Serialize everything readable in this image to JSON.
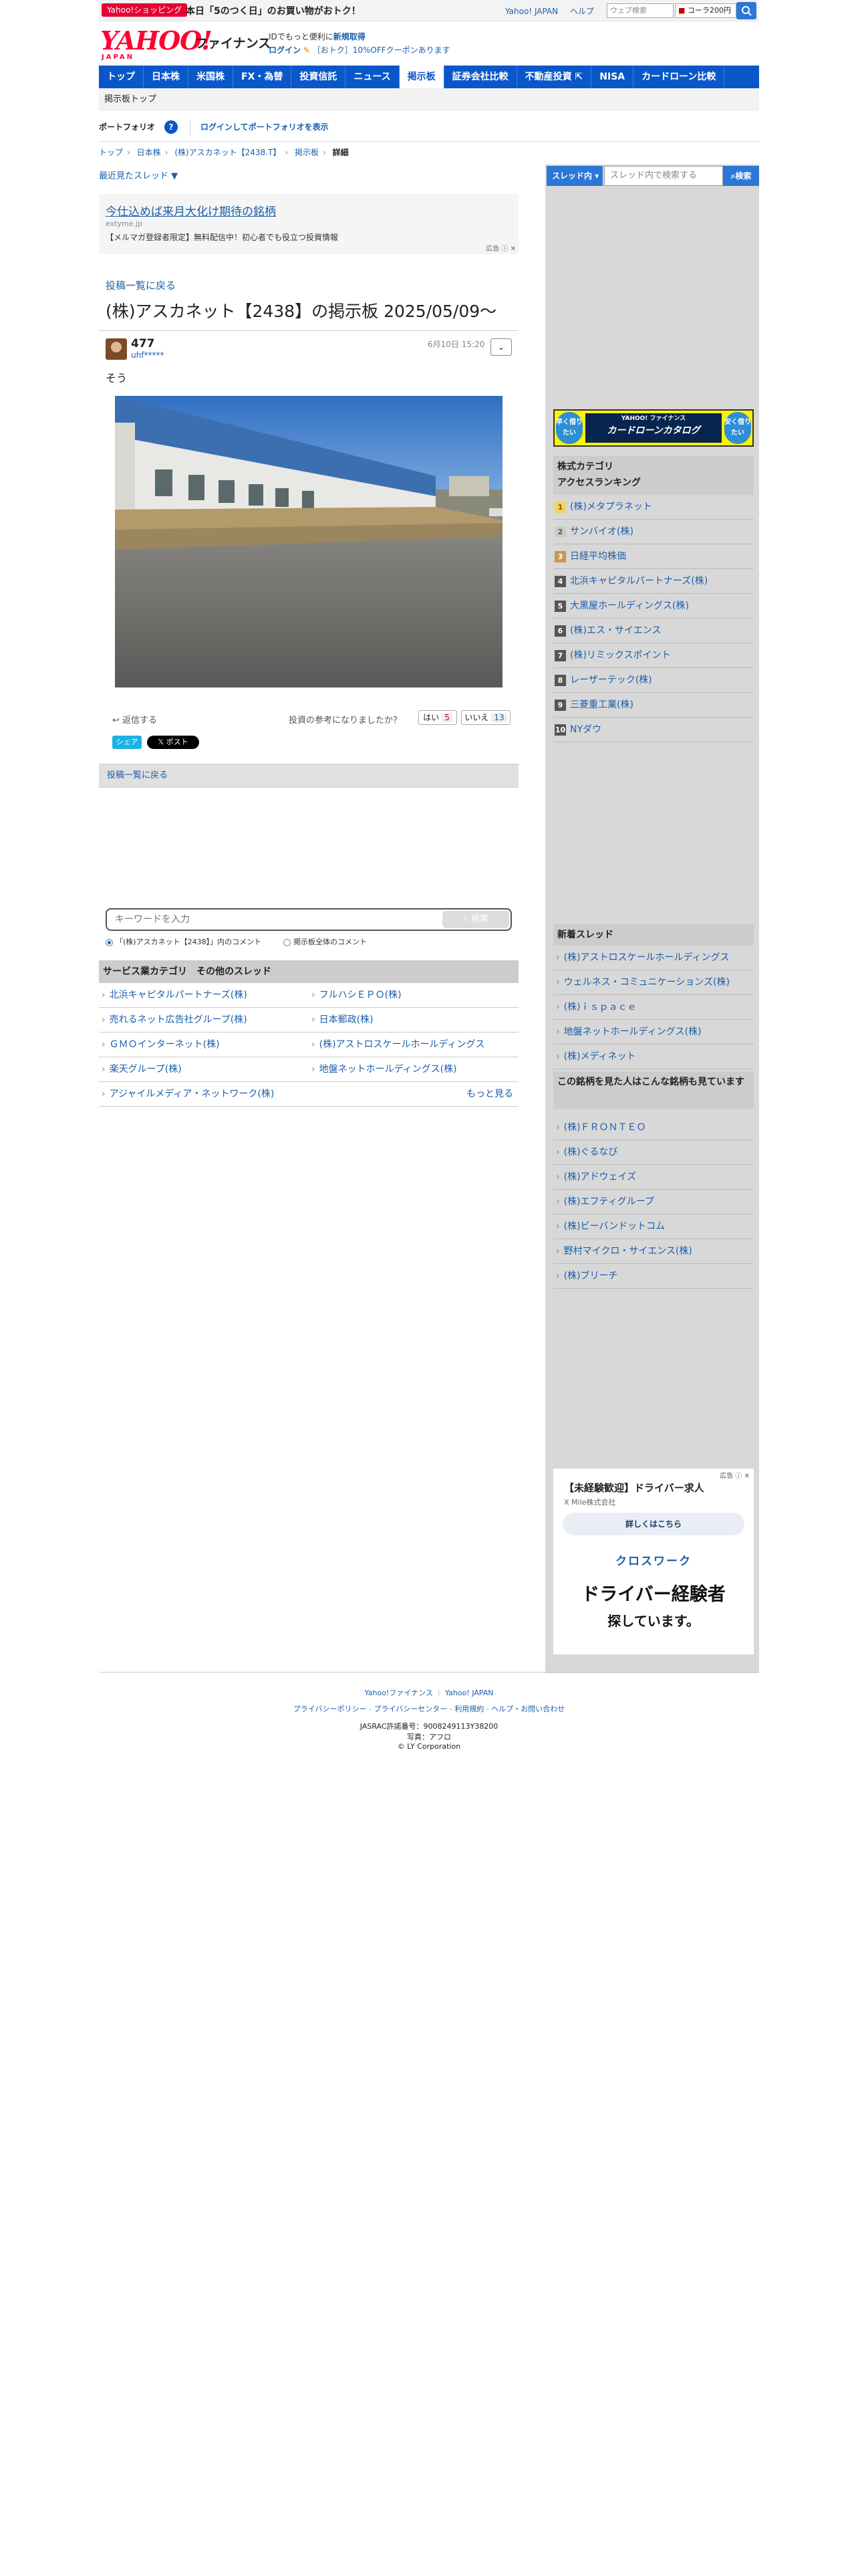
{
  "topbar": {
    "shopping_badge": "Yahoo!ショッピング",
    "shopping_text": "本日「5のつく日」のお買い物がおトク！",
    "links": [
      "Yahoo! JAPAN",
      "ヘルプ"
    ],
    "web_search_placeholder": "ウェブ検索",
    "coupon_text": "コーラ200円"
  },
  "header": {
    "logo": "YAHOO!",
    "logo_sub": "JAPAN",
    "site_name": "ファイナンス",
    "promo_line1_a": "IDでもっと便利に",
    "promo_line1_b": "新規取得",
    "promo_line2_a": "ログイン",
    "promo_line2_b": "［おトク］10%OFFクーポンあります"
  },
  "nav": {
    "items": [
      "トップ",
      "日本株",
      "米国株",
      "FX・為替",
      "投資信託",
      "ニュース",
      "掲示板",
      "証券会社比較",
      "不動産投資 ⇱",
      "NISA",
      "カードローン比較"
    ],
    "active": "掲示板"
  },
  "subnav": {
    "label": "掲示板トップ"
  },
  "portfolio": {
    "label": "ポートフォリオ",
    "help": "?",
    "login_text": "ログインしてポートフォリオを表示"
  },
  "breadcrumb": [
    "トップ",
    "日本株",
    "(株)アスカネット【2438.T】",
    "掲示板",
    "詳細"
  ],
  "recent_threads": "最近見たスレッド ▼",
  "ad_banner": {
    "title": "今仕込めば来月大化け期待の銘柄",
    "url": "extyme.jp",
    "desc": "【メルマガ登録者限定】無料配信中！初心者でも役立つ投資情報",
    "mark": "広告 ⓘ ✕"
  },
  "post": {
    "back_link": "投稿一覧に戻る",
    "board_title": "(株)アスカネット【2438】の掲示板 2025/05/09〜",
    "number": "477",
    "user": "uhf*****",
    "date": "6月10日 15:20",
    "text": "そう",
    "reply": "返信する",
    "useful_question": "投資の参考になりましたか？",
    "yes_label": "はい",
    "yes_count": "5",
    "no_label": "いいえ",
    "no_count": "13",
    "share_label": "シェア",
    "post_label": "ポスト"
  },
  "back_link2": "投稿一覧に戻る",
  "keyword_search": {
    "placeholder": "キーワードを入力",
    "button": "検索",
    "option_in_board": "「(株)アスカネット【2438】」内のコメント",
    "option_all": "掲示板全体のコメント"
  },
  "other_threads": {
    "heading": "サービス業カテゴリ　その他のスレッド",
    "items": [
      [
        "北浜キャピタルパートナーズ(株)",
        "フルハシＥＰＯ(株)"
      ],
      [
        "売れるネット広告社グループ(株)",
        "日本郵政(株)"
      ],
      [
        "ＧＭＯインターネット(株)",
        "(株)アストロスケールホールディングス"
      ],
      [
        "楽天グループ(株)",
        "地盤ネットホールディングス(株)"
      ],
      [
        "アジャイルメディア・ネットワーク(株)"
      ]
    ],
    "more": "もっと見る"
  },
  "sidebar": {
    "thread_select": "スレッド内 ▾",
    "search_placeholder": "スレッド内で検索する",
    "search_button": "検索",
    "cardloan": {
      "left": "早く借りたい",
      "center_small": "YAHOO! ファイナンス",
      "center": "カードローンカタログ",
      "right": "安く借りたい"
    },
    "ranking_title": "株式カテゴリ\nアクセスランキング",
    "ranking": [
      "(株)メタプラネット",
      "サンバイオ(株)",
      "日経平均株価",
      "北浜キャピタルパートナーズ(株)",
      "大黒屋ホールディングス(株)",
      "(株)エス・サイエンス",
      "(株)リミックスポイント",
      "レーザーテック(株)",
      "三菱重工業(株)",
      "NYダウ"
    ],
    "new_threads_title": "新着スレッド",
    "new_threads": [
      "(株)アストロスケールホールディングス",
      "ウェルネス・コミュニケーションズ(株)",
      "(株)ｉｓｐａｃｅ",
      "地盤ネットホールディングス(株)",
      "(株)メディネット"
    ],
    "also_viewed_title": "この銘柄を見た人はこんな銘柄も見ています",
    "also_viewed": [
      "(株)ＦＲＯＮＴＥＯ",
      "(株)ぐるなび",
      "(株)アドウェイズ",
      "(株)エフティグループ",
      "(株)ビーバンドットコム",
      "野村マイクロ・サイエンス(株)",
      "(株)ブリーチ"
    ],
    "ad2": {
      "mark": "広告 ⓘ ✕",
      "title": "【未経験歓迎】ドライバー求人",
      "company": "X Mile株式会社",
      "button": "詳しくはこちら",
      "logo": "クロスワーク",
      "big": "ドライバー経験者",
      "big2": "探しています。"
    }
  },
  "footer": {
    "line1": [
      "Yahoo!ファイナンス",
      "Yahoo! JAPAN"
    ],
    "line2": [
      "プライバシーポリシー",
      "プライバシーセンター",
      "利用規約",
      "ヘルプ・お問い合わせ"
    ],
    "jasrac": "JASRAC許諾番号：9008249113Y38200",
    "photo": "写真：アフロ",
    "copyright": "© LY Corporation"
  }
}
